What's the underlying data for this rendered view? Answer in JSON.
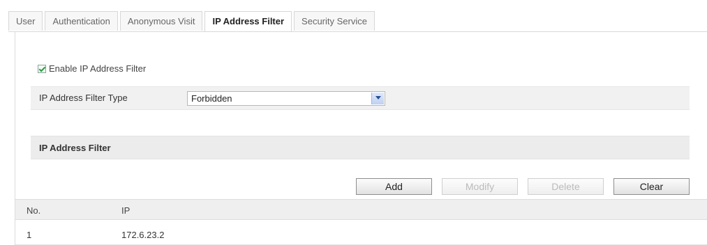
{
  "tabs": [
    {
      "label": "User"
    },
    {
      "label": "Authentication"
    },
    {
      "label": "Anonymous Visit"
    },
    {
      "label": "IP Address Filter",
      "active": true
    },
    {
      "label": "Security Service"
    }
  ],
  "filter": {
    "enable_label": "Enable IP Address Filter",
    "enabled": true,
    "type_label": "IP Address Filter Type",
    "type_value": "Forbidden"
  },
  "section": {
    "title": "IP Address Filter"
  },
  "buttons": {
    "add": "Add",
    "modify": "Modify",
    "delete": "Delete",
    "clear": "Clear"
  },
  "table": {
    "headers": [
      "No.",
      "IP"
    ],
    "rows": [
      {
        "no": "1",
        "ip": "172.6.23.2"
      }
    ]
  }
}
